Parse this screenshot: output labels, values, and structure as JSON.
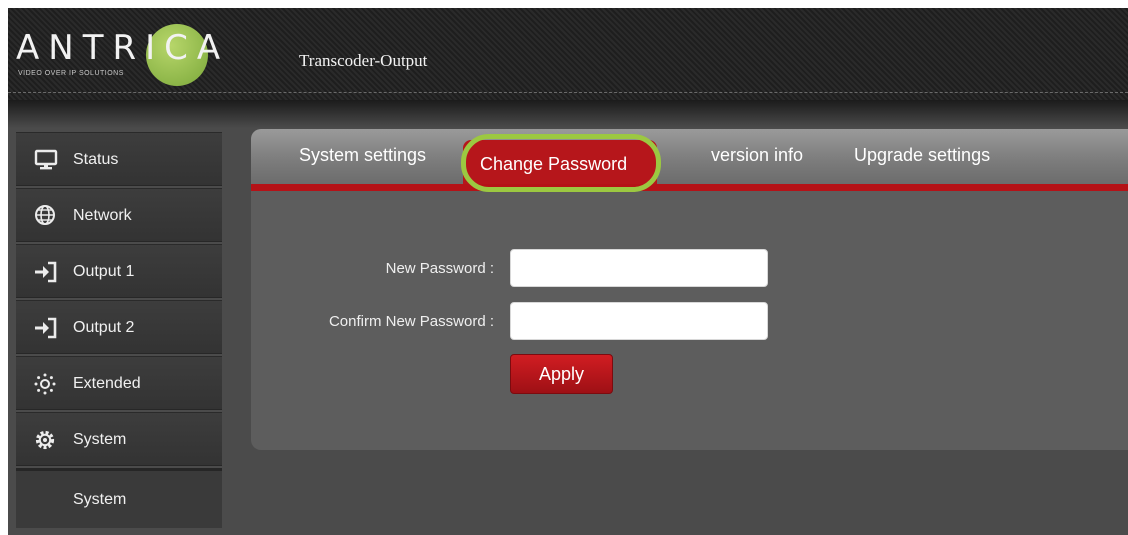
{
  "header": {
    "logo_text": "ANTRICA",
    "logo_tagline": "VIDEO OVER IP SOLUTIONS",
    "page_title": "Transcoder-Output"
  },
  "sidebar": {
    "items": [
      {
        "label": "Status",
        "icon": "monitor-icon"
      },
      {
        "label": "Network",
        "icon": "globe-icon"
      },
      {
        "label": "Output 1",
        "icon": "sign-in-arrow-icon"
      },
      {
        "label": "Output 2",
        "icon": "sign-in-arrow-icon"
      },
      {
        "label": "Extended",
        "icon": "dotted-sun-icon"
      },
      {
        "label": "System",
        "icon": "gear-icon"
      }
    ],
    "submenu": {
      "label": "System"
    }
  },
  "tabs": [
    {
      "label": "System settings"
    },
    {
      "label": "Change Password",
      "active": true
    },
    {
      "label": "version info"
    },
    {
      "label": "Upgrade settings"
    }
  ],
  "form": {
    "new_password_label": "New Password :",
    "new_password_value": "",
    "confirm_password_label": "Confirm New Password :",
    "confirm_password_value": "",
    "apply_label": "Apply"
  },
  "colors": {
    "accent_red": "#b6161b",
    "highlight_green": "#9cc841",
    "logo_green": "#7ba83a"
  }
}
